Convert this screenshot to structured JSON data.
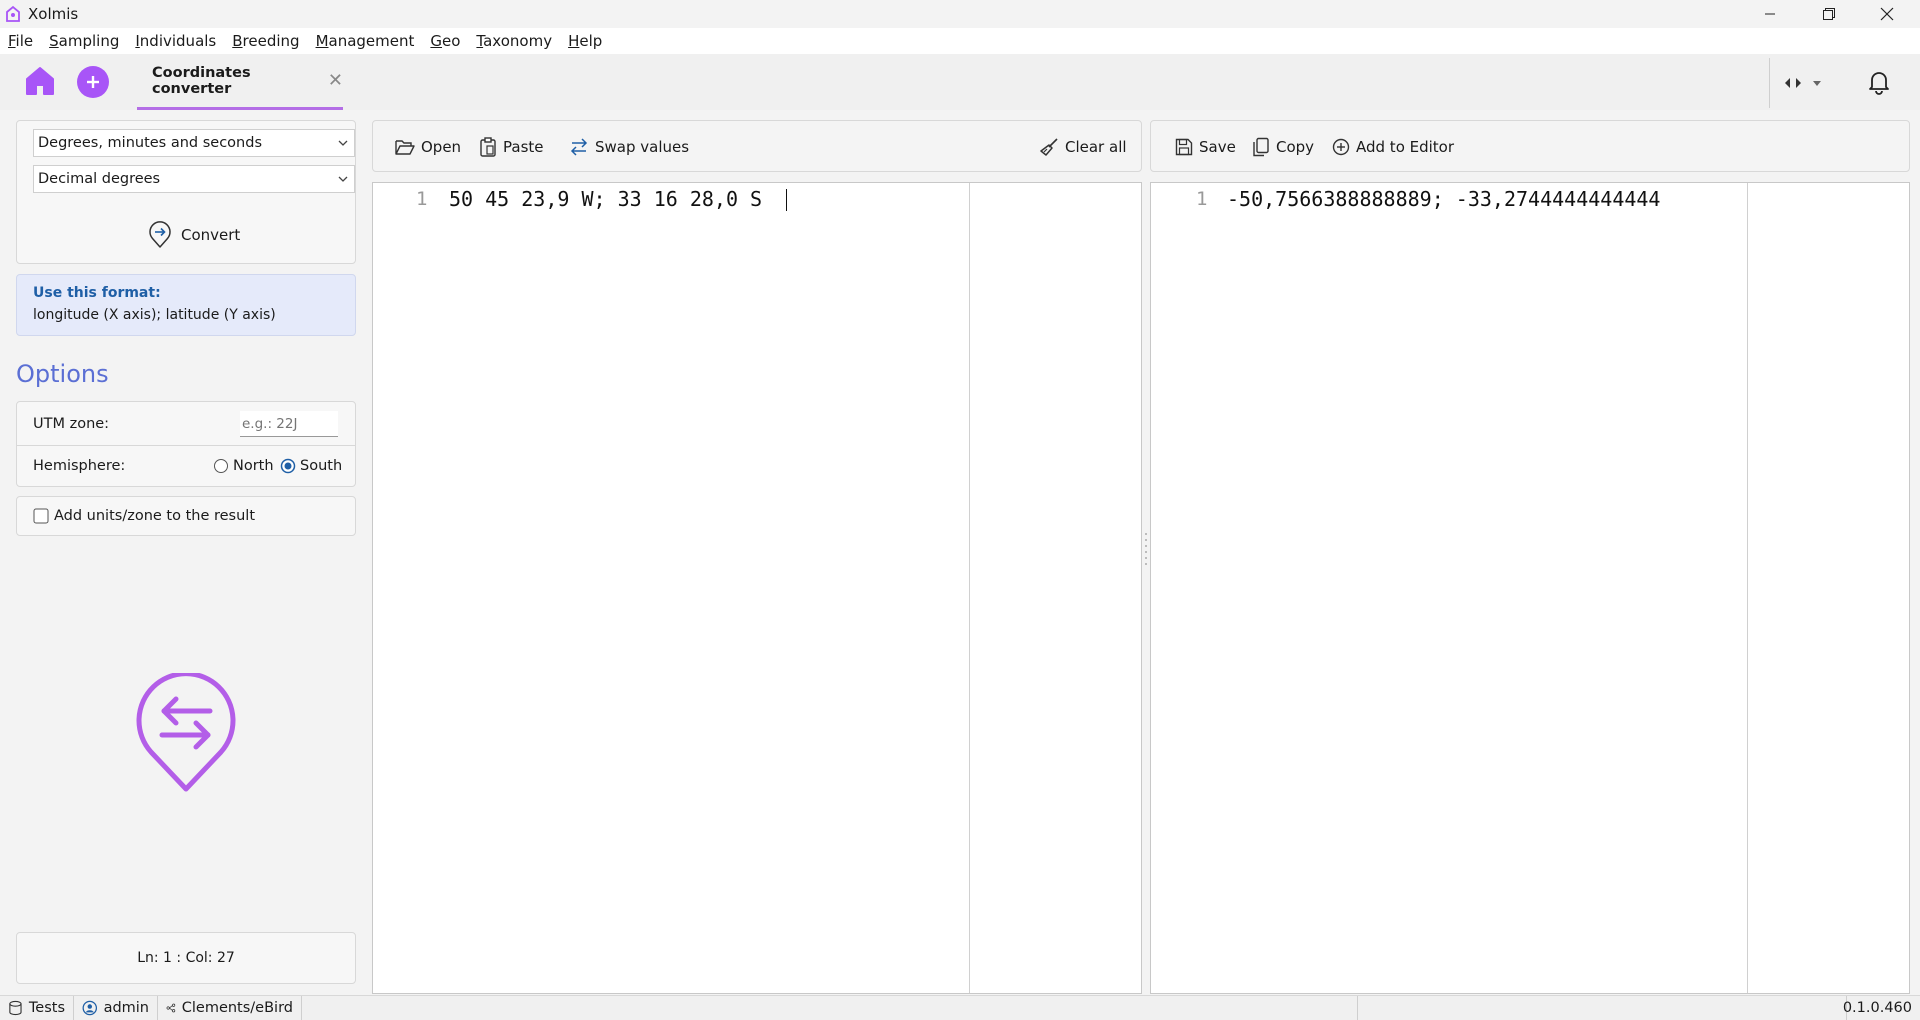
{
  "window": {
    "title": "Xolmis"
  },
  "menu": [
    "File",
    "Sampling",
    "Individuals",
    "Breeding",
    "Management",
    "Geo",
    "Taxonomy",
    "Help"
  ],
  "tab": {
    "label": "Coordinates converter"
  },
  "converter": {
    "from_format": "Degrees, minutes and seconds",
    "to_format": "Decimal degrees",
    "convert_label": "Convert"
  },
  "info": {
    "title": "Use this format:",
    "text": "longitude (X axis); latitude (Y axis)"
  },
  "options": {
    "title": "Options",
    "utm_label": "UTM zone:",
    "utm_placeholder": "e.g.: 22J",
    "hemisphere_label": "Hemisphere:",
    "north_label": "North",
    "south_label": "South",
    "hemisphere_selected": "South",
    "add_units_label": "Add units/zone to the result",
    "add_units_checked": false
  },
  "cursor_position": "Ln: 1 : Col: 27",
  "input_toolbar": {
    "open": "Open",
    "paste": "Paste",
    "swap": "Swap values",
    "clear": "Clear all"
  },
  "output_toolbar": {
    "save": "Save",
    "copy": "Copy",
    "add_editor": "Add to Editor"
  },
  "input_editor": {
    "line_number": "1",
    "text": "50 45 23,9 W; 33 16 28,0 S"
  },
  "output_editor": {
    "line_number": "1",
    "text": "-50,7566388888889; -33,2744444444444"
  },
  "status": {
    "tests": "Tests",
    "user": "admin",
    "taxonomy": "Clements/eBird",
    "version": "0.1.0.460"
  },
  "colors": {
    "accent": "#a855f7",
    "tab_underline": "#b46ee6",
    "info_bg": "#e5eafa",
    "options_title": "#5b6fd4"
  }
}
